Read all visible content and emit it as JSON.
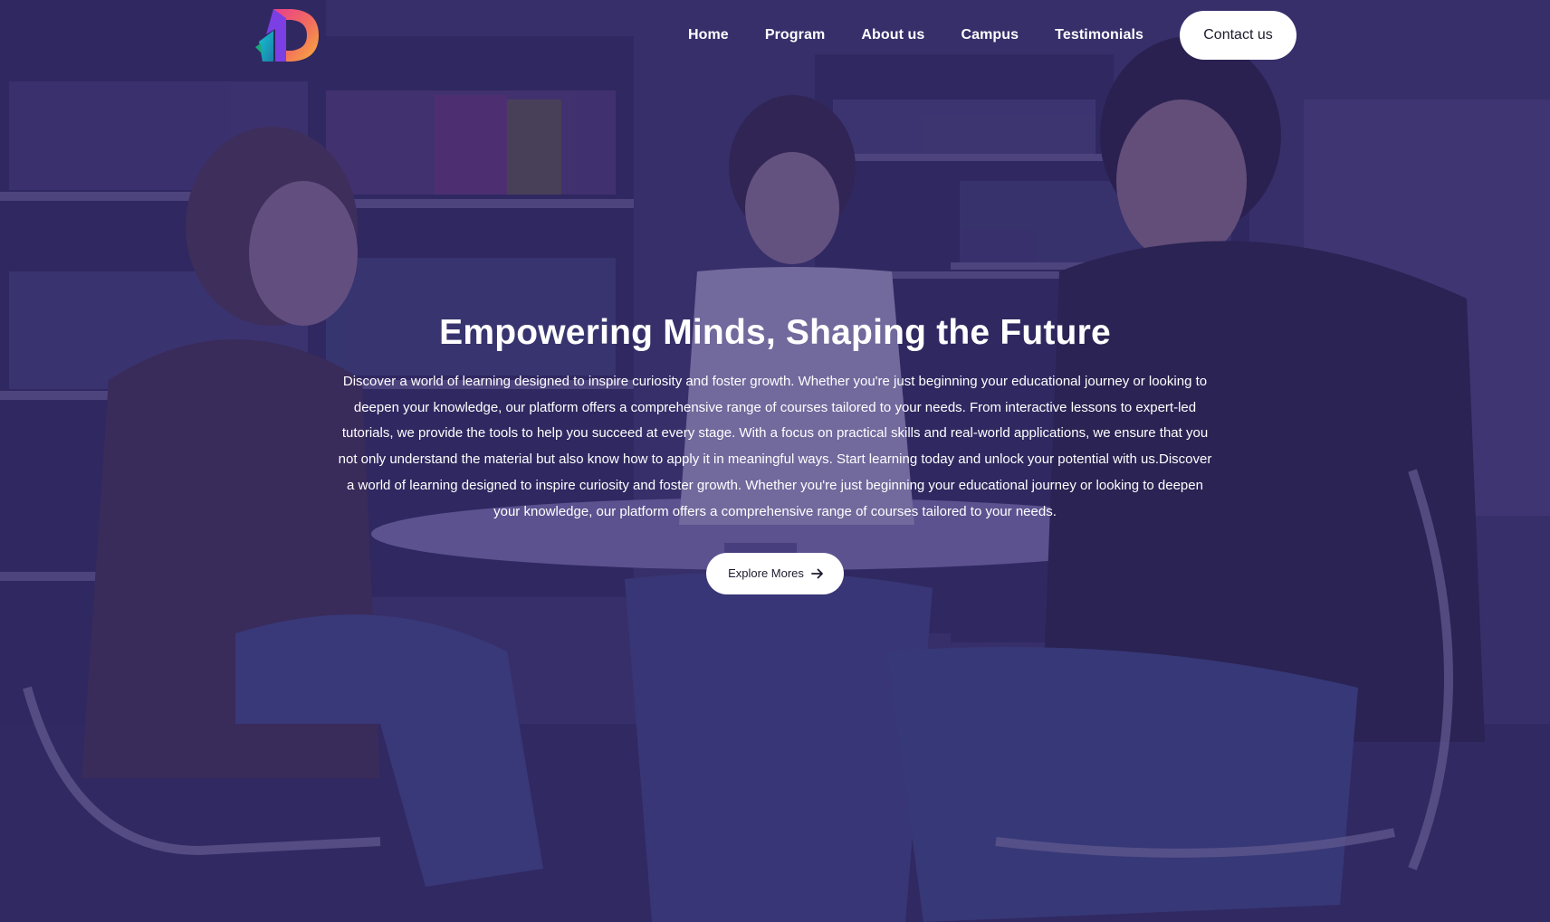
{
  "nav": {
    "links": [
      "Home",
      "Program",
      "About us",
      "Campus",
      "Testimonials"
    ],
    "contact_label": "Contact us"
  },
  "hero": {
    "title": "Empowering Minds, Shaping the Future",
    "description": "Discover a world of learning designed to inspire curiosity and foster growth. Whether you're just beginning your educational journey or looking to deepen your knowledge, our platform offers a comprehensive range of courses tailored to your needs. From interactive lessons to expert-led tutorials, we provide the tools to help you succeed at every stage. With a focus on practical skills and real-world applications, we ensure that you not only understand the material but also know how to apply it in meaningful ways. Start learning today and unlock your potential with us.Discover a world of learning designed to inspire curiosity and foster growth. Whether you're just beginning your educational journey or looking to deepen your knowledge, our platform offers a comprehensive range of courses tailored to your needs.",
    "cta_label": "Explore Mores",
    "cta_icon": "arrow-right-icon"
  },
  "logo": {
    "icon": "d-logo-icon",
    "colors": [
      "#e83e8c",
      "#f7a23b",
      "#17b5c9",
      "#7b3fe4"
    ]
  },
  "colors": {
    "overlay": "#342a6e",
    "button_bg": "#ffffff",
    "button_text": "#1d1b2e"
  },
  "background": {
    "description_icon": "library-students-photo"
  }
}
